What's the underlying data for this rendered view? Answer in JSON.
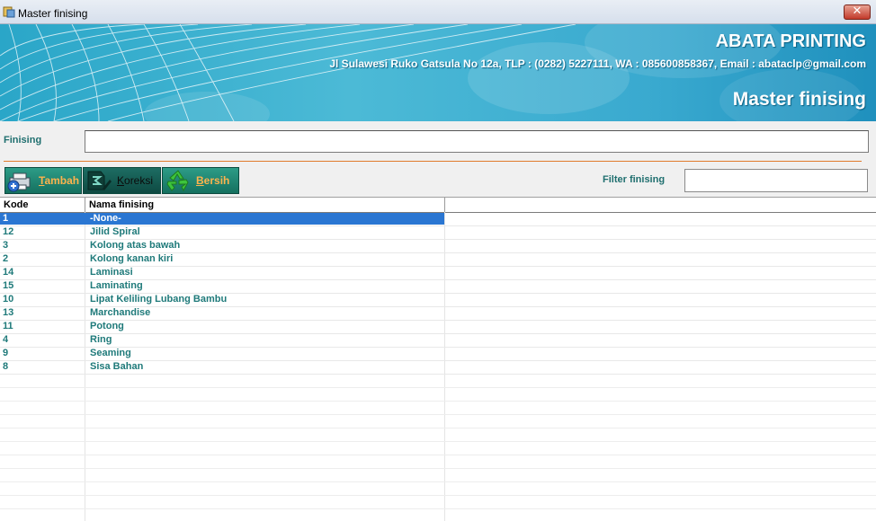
{
  "window": {
    "title": "Master finising",
    "close_glyph": "✕"
  },
  "banner": {
    "company": "ABATA PRINTING",
    "address": "Jl Sulawesi Ruko Gatsula No 12a, TLP : (0282) 5227111, WA : 085600858367, Email : abataclp@gmail.com",
    "form_title": "Master finising"
  },
  "form": {
    "finishing_label": "Finising",
    "finishing_value": "",
    "filter_label": "Filter finising",
    "filter_value": ""
  },
  "toolbar": {
    "tambah_key": "T",
    "tambah_rest": "ambah",
    "koreksi_key": "K",
    "koreksi_rest": "oreksi",
    "bersih_key": "B",
    "bersih_rest": "ersih"
  },
  "grid": {
    "columns": [
      "Kode",
      "Nama finising"
    ],
    "selected_index": 0,
    "rows": [
      {
        "kode": "1",
        "nama": "-None-"
      },
      {
        "kode": "12",
        "nama": "Jilid Spiral"
      },
      {
        "kode": "3",
        "nama": "Kolong atas bawah"
      },
      {
        "kode": "2",
        "nama": "Kolong kanan kiri"
      },
      {
        "kode": "14",
        "nama": "Laminasi"
      },
      {
        "kode": "15",
        "nama": "Laminating"
      },
      {
        "kode": "10",
        "nama": "Lipat Keliling Lubang Bambu"
      },
      {
        "kode": "13",
        "nama": "Marchandise"
      },
      {
        "kode": "11",
        "nama": "Potong"
      },
      {
        "kode": "4",
        "nama": "Ring"
      },
      {
        "kode": "9",
        "nama": "Seaming"
      },
      {
        "kode": "8",
        "nama": "Sisa Bahan"
      }
    ]
  },
  "colors": {
    "accent": "#2a76d2",
    "text_teal": "#1f7a7a",
    "button_bg": "#15705f",
    "button_label": "#ffb34d",
    "divider": "#e07b2c"
  }
}
